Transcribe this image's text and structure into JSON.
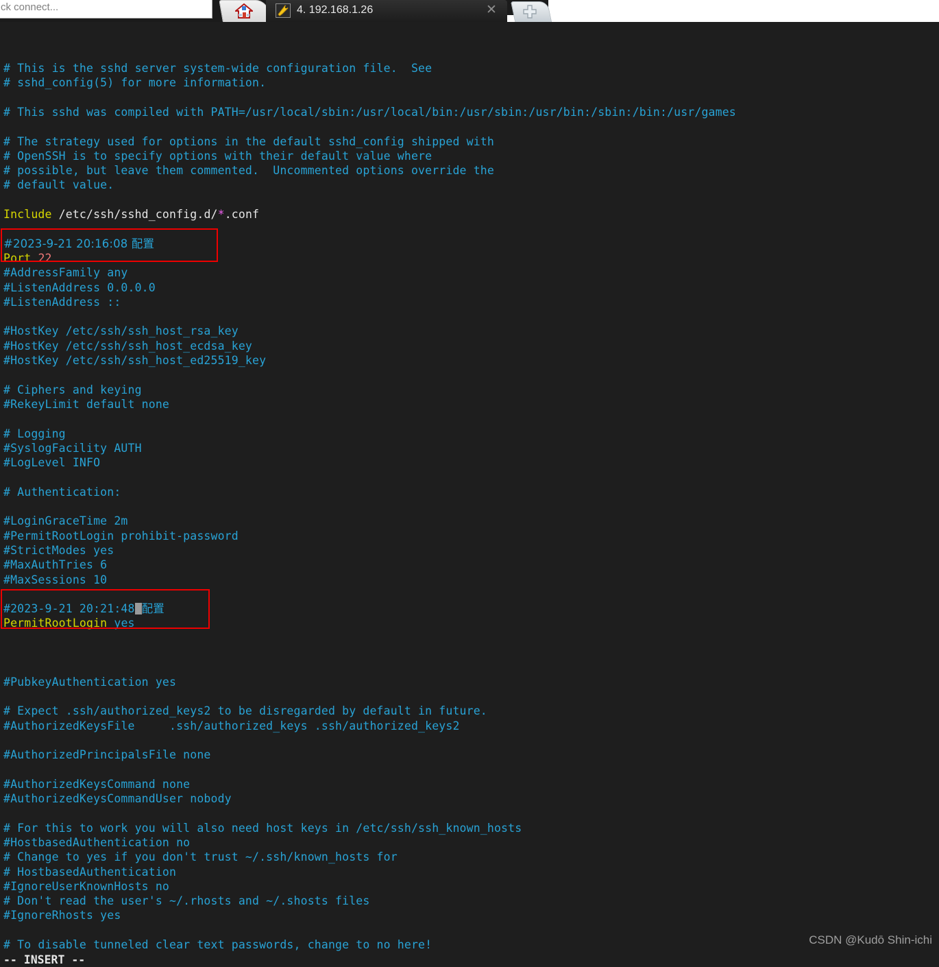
{
  "window": {
    "address_bar": {
      "value": "ck connect...",
      "placeholder": "ck connect..."
    },
    "tabs": {
      "home_tab": {
        "icon": "home-icon",
        "label": ""
      },
      "active_tab": {
        "icon": "wrench-icon",
        "label": "4. 192.168.1.26",
        "close_label": "✕"
      },
      "new_tab": {
        "icon": "plus-icon",
        "label": ""
      }
    }
  },
  "terminal": {
    "editor_mode": "-- INSERT --",
    "watermark": "CSDN @Kudō Shin-ichi",
    "colors": {
      "background": "#1e1e1e",
      "comment": "#28a3d6",
      "keyword": "#d7d700",
      "plain": "#e6e6e6",
      "glob": "#ee5fee",
      "number": "#f07878",
      "highlight_box": "#ee0000",
      "cursor": "#9a9a9a"
    },
    "file": "sshd_config",
    "highlight_boxes": [
      {
        "name": "port-config-box",
        "lines": [
          "#2023-9-21 20:16:08 配置",
          "Port 22"
        ]
      },
      {
        "name": "permitrootlogin-config-box",
        "lines": [
          "#2023-9-21 20:21:48 配置",
          "PermitRootLogin yes"
        ]
      }
    ],
    "lines": [
      {
        "i": 0,
        "spans": [
          {
            "t": "# This is the sshd server system-wide configuration file.  See",
            "c": "com"
          }
        ]
      },
      {
        "i": 1,
        "spans": [
          {
            "t": "# sshd_config(5) for more information.",
            "c": "com"
          }
        ]
      },
      {
        "i": 2,
        "spans": []
      },
      {
        "i": 3,
        "spans": [
          {
            "t": "# This sshd was compiled with PATH=/usr/local/sbin:/usr/local/bin:/usr/sbin:/usr/bin:/sbin:/bin:/usr/games",
            "c": "com"
          }
        ]
      },
      {
        "i": 4,
        "spans": []
      },
      {
        "i": 5,
        "spans": [
          {
            "t": "# The strategy used for options in the default sshd_config shipped with",
            "c": "com"
          }
        ]
      },
      {
        "i": 6,
        "spans": [
          {
            "t": "# OpenSSH is to specify options with their default value where",
            "c": "com"
          }
        ]
      },
      {
        "i": 7,
        "spans": [
          {
            "t": "# possible, but leave them commented.  Uncommented options override the",
            "c": "com"
          }
        ]
      },
      {
        "i": 8,
        "spans": [
          {
            "t": "# default value.",
            "c": "com"
          }
        ]
      },
      {
        "i": 9,
        "spans": []
      },
      {
        "i": 10,
        "spans": [
          {
            "t": "Include",
            "c": "key"
          },
          {
            "t": " /etc/ssh/sshd_config.d/",
            "c": "path"
          },
          {
            "t": "*",
            "c": "star"
          },
          {
            "t": ".conf",
            "c": "path"
          }
        ]
      },
      {
        "i": 11,
        "spans": []
      },
      {
        "i": 12,
        "spans": [
          {
            "t": "#2023-9-21 20:16:08 配置",
            "c": "com"
          }
        ]
      },
      {
        "i": 13,
        "spans": [
          {
            "t": "Port",
            "c": "key"
          },
          {
            "t": " ",
            "c": "path"
          },
          {
            "t": "22",
            "c": "num"
          }
        ]
      },
      {
        "i": 14,
        "spans": [
          {
            "t": "#AddressFamily any",
            "c": "com"
          }
        ]
      },
      {
        "i": 15,
        "spans": [
          {
            "t": "#ListenAddress 0.0.0.0",
            "c": "com"
          }
        ]
      },
      {
        "i": 16,
        "spans": [
          {
            "t": "#ListenAddress ::",
            "c": "com"
          }
        ]
      },
      {
        "i": 17,
        "spans": []
      },
      {
        "i": 18,
        "spans": [
          {
            "t": "#HostKey /etc/ssh/ssh_host_rsa_key",
            "c": "com"
          }
        ]
      },
      {
        "i": 19,
        "spans": [
          {
            "t": "#HostKey /etc/ssh/ssh_host_ecdsa_key",
            "c": "com"
          }
        ]
      },
      {
        "i": 20,
        "spans": [
          {
            "t": "#HostKey /etc/ssh/ssh_host_ed25519_key",
            "c": "com"
          }
        ]
      },
      {
        "i": 21,
        "spans": []
      },
      {
        "i": 22,
        "spans": [
          {
            "t": "# Ciphers and keying",
            "c": "com"
          }
        ]
      },
      {
        "i": 23,
        "spans": [
          {
            "t": "#RekeyLimit default none",
            "c": "com"
          }
        ]
      },
      {
        "i": 24,
        "spans": []
      },
      {
        "i": 25,
        "spans": [
          {
            "t": "# Logging",
            "c": "com"
          }
        ]
      },
      {
        "i": 26,
        "spans": [
          {
            "t": "#SyslogFacility AUTH",
            "c": "com"
          }
        ]
      },
      {
        "i": 27,
        "spans": [
          {
            "t": "#LogLevel INFO",
            "c": "com"
          }
        ]
      },
      {
        "i": 28,
        "spans": []
      },
      {
        "i": 29,
        "spans": [
          {
            "t": "# Authentication:",
            "c": "com"
          }
        ]
      },
      {
        "i": 30,
        "spans": []
      },
      {
        "i": 31,
        "spans": [
          {
            "t": "#LoginGraceTime 2m",
            "c": "com"
          }
        ]
      },
      {
        "i": 32,
        "spans": [
          {
            "t": "#PermitRootLogin prohibit-password",
            "c": "com"
          }
        ]
      },
      {
        "i": 33,
        "spans": [
          {
            "t": "#StrictModes yes",
            "c": "com"
          }
        ]
      },
      {
        "i": 34,
        "spans": [
          {
            "t": "#MaxAuthTries 6",
            "c": "com"
          }
        ]
      },
      {
        "i": 35,
        "spans": [
          {
            "t": "#MaxSessions 10",
            "c": "com"
          }
        ]
      },
      {
        "i": 36,
        "spans": []
      },
      {
        "i": 37,
        "spans": [
          {
            "t": "#2023-9-21 20:21:48",
            "c": "com"
          },
          {
            "t": "",
            "c": "cursor"
          },
          {
            "t": "配置",
            "c": "com"
          }
        ]
      },
      {
        "i": 38,
        "spans": [
          {
            "t": "PermitRootLogin",
            "c": "key"
          },
          {
            "t": " ",
            "c": "path"
          },
          {
            "t": "yes",
            "c": "val"
          }
        ]
      },
      {
        "i": 39,
        "spans": []
      },
      {
        "i": 40,
        "spans": []
      },
      {
        "i": 41,
        "spans": []
      },
      {
        "i": 42,
        "spans": [
          {
            "t": "#PubkeyAuthentication yes",
            "c": "com"
          }
        ]
      },
      {
        "i": 43,
        "spans": []
      },
      {
        "i": 44,
        "spans": [
          {
            "t": "# Expect .ssh/authorized_keys2 to be disregarded by default in future.",
            "c": "com"
          }
        ]
      },
      {
        "i": 45,
        "spans": [
          {
            "t": "#AuthorizedKeysFile     .ssh/authorized_keys .ssh/authorized_keys2",
            "c": "com"
          }
        ]
      },
      {
        "i": 46,
        "spans": []
      },
      {
        "i": 47,
        "spans": [
          {
            "t": "#AuthorizedPrincipalsFile none",
            "c": "com"
          }
        ]
      },
      {
        "i": 48,
        "spans": []
      },
      {
        "i": 49,
        "spans": [
          {
            "t": "#AuthorizedKeysCommand none",
            "c": "com"
          }
        ]
      },
      {
        "i": 50,
        "spans": [
          {
            "t": "#AuthorizedKeysCommandUser nobody",
            "c": "com"
          }
        ]
      },
      {
        "i": 51,
        "spans": []
      },
      {
        "i": 52,
        "spans": [
          {
            "t": "# For this to work you will also need host keys in /etc/ssh/ssh_known_hosts",
            "c": "com"
          }
        ]
      },
      {
        "i": 53,
        "spans": [
          {
            "t": "#HostbasedAuthentication no",
            "c": "com"
          }
        ]
      },
      {
        "i": 54,
        "spans": [
          {
            "t": "# Change to yes if you don't trust ~/.ssh/known_hosts for",
            "c": "com"
          }
        ]
      },
      {
        "i": 55,
        "spans": [
          {
            "t": "# HostbasedAuthentication",
            "c": "com"
          }
        ]
      },
      {
        "i": 56,
        "spans": [
          {
            "t": "#IgnoreUserKnownHosts no",
            "c": "com"
          }
        ]
      },
      {
        "i": 57,
        "spans": [
          {
            "t": "# Don't read the user's ~/.rhosts and ~/.shosts files",
            "c": "com"
          }
        ]
      },
      {
        "i": 58,
        "spans": [
          {
            "t": "#IgnoreRhosts yes",
            "c": "com"
          }
        ]
      },
      {
        "i": 59,
        "spans": []
      },
      {
        "i": 60,
        "spans": [
          {
            "t": "# To disable tunneled clear text passwords, change to no here!",
            "c": "com"
          }
        ]
      }
    ]
  }
}
